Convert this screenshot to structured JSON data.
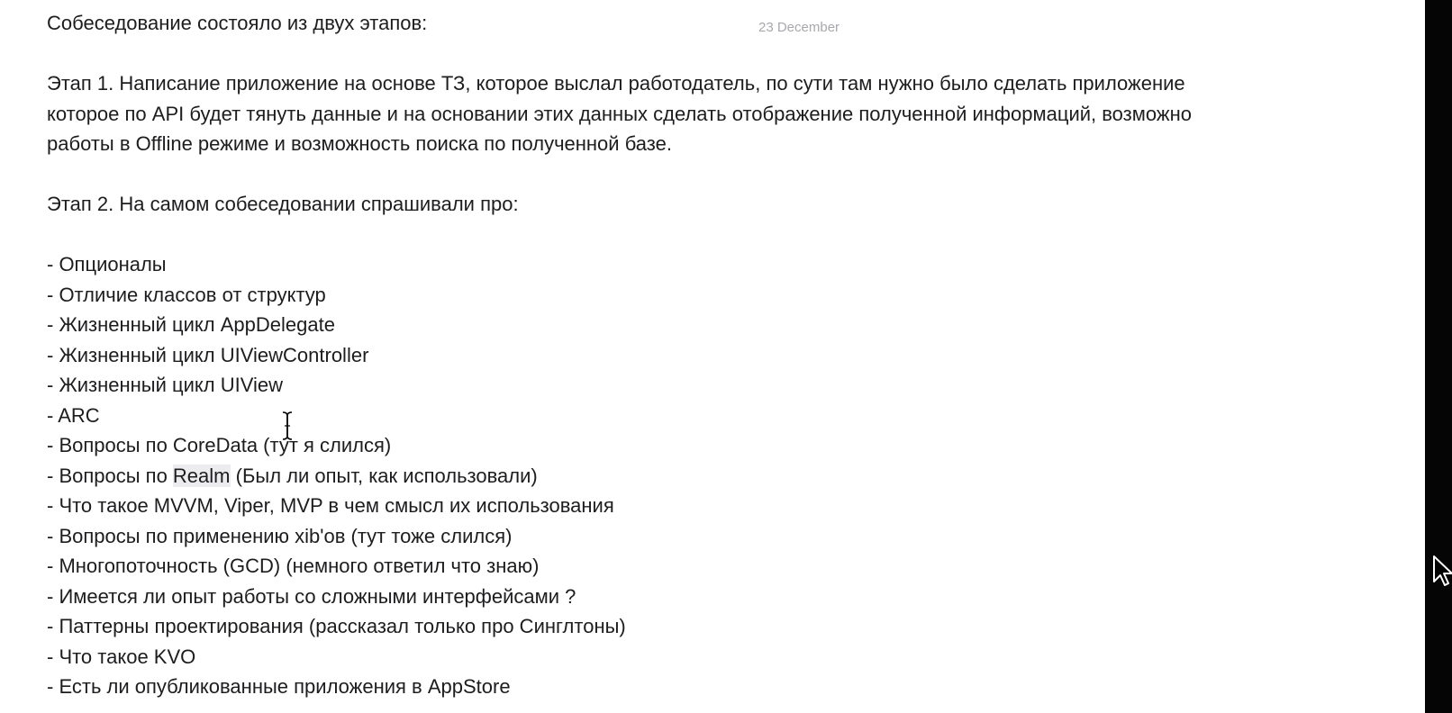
{
  "date": "23 December",
  "intro": "Собеседование состояло из двух этапов:",
  "stage1": {
    "line1": "Этап 1. Написание приложение на основе ТЗ, которое выслал работодатель, по сути там нужно было сделать приложение",
    "line2": "которое по API будет тянуть данные и на основании этих данных сделать отображение полученной информаций, возможно",
    "line3": "работы в Offline режиме и возможность поиска по полученной базе."
  },
  "stage2": "Этап 2. На самом собеседовании спрашивали про:",
  "questions": [
    "- Опционалы",
    "- Отличие классов от структур",
    "- Жизненный цикл AppDelegate",
    "- Жизненный цикл UIViewController",
    "- Жизненный цикл UIView",
    "- ARC",
    "- Вопросы по CoreData (тут я слился)",
    {
      "prefix": "- Вопросы по ",
      "highlight": "Realm",
      "suffix": " (Был ли опыт, как использовали)"
    },
    "- Что такое MVVM, Viper, MVP в чем смысл их использования",
    "- Вопросы по применению xib'ов (тут тоже слился)",
    "- Многопоточность (GCD) (немного ответил что знаю)",
    "- Имеется ли опыт работы со сложными интерфейсами ?",
    "- Паттерны проектирования (рассказал только про Синглтоны)",
    "- Что такое KVO",
    "- Есть ли опубликованные приложения в AppStore"
  ],
  "icons": {
    "text_cursor": "i-beam-cursor-icon",
    "pointer": "arrow-cursor-icon"
  },
  "colors": {
    "text": "#1d1d1f",
    "date": "#a8a8ad",
    "highlight": "#ececef",
    "right_edge": "#050505"
  }
}
